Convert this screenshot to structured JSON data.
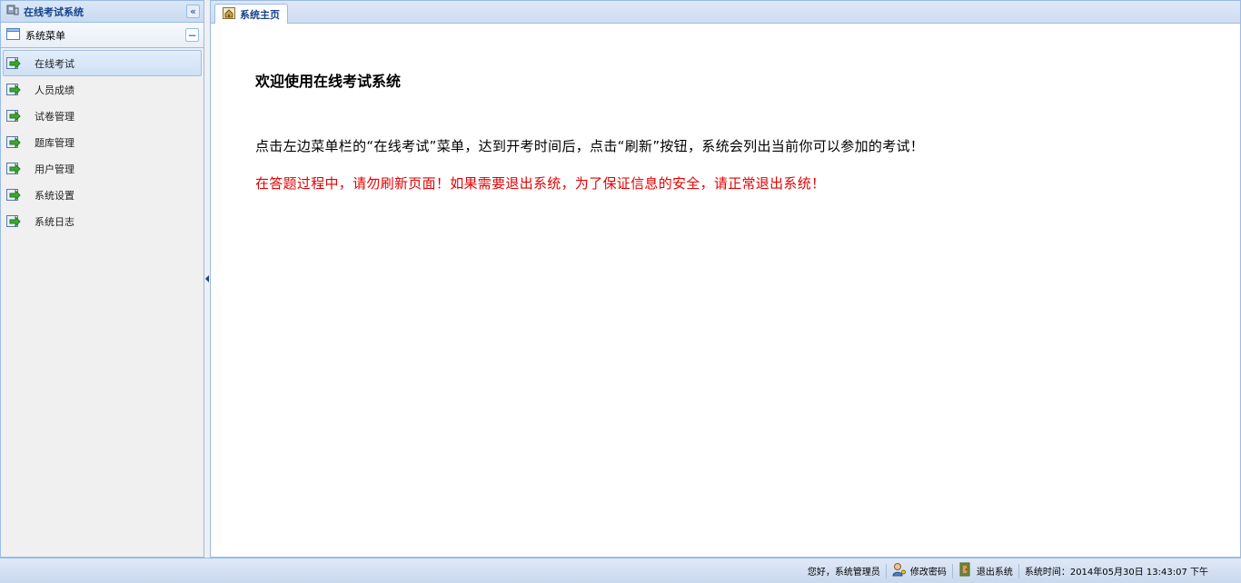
{
  "west": {
    "title": "在线考试系统",
    "collapse_glyph": "«",
    "accordion_label": "系统菜单",
    "accordion_toggle": "−",
    "menu": [
      {
        "label": "在线考试",
        "icon": "arrow-right-icon"
      },
      {
        "label": "人员成绩",
        "icon": "arrow-right-icon"
      },
      {
        "label": "试卷管理",
        "icon": "arrow-right-icon"
      },
      {
        "label": "题库管理",
        "icon": "arrow-right-icon"
      },
      {
        "label": "用户管理",
        "icon": "arrow-right-icon"
      },
      {
        "label": "系统设置",
        "icon": "arrow-right-icon"
      },
      {
        "label": "系统日志",
        "icon": "arrow-right-icon"
      }
    ]
  },
  "tabs": [
    {
      "label": "系统主页",
      "icon": "home-icon"
    }
  ],
  "content": {
    "welcome": "欢迎使用在线考试系统",
    "instruction": "点击左边菜单栏的“在线考试”菜单，达到开考时间后，点击“刷新”按钮，系统会列出当前你可以参加的考试！",
    "warning": "在答题过程中，请勿刷新页面！如果需要退出系统，为了保证信息的安全，请正常退出系统！"
  },
  "footer": {
    "greeting": "您好，系统管理员",
    "change_password": "修改密码",
    "logout": "退出系统",
    "time_label": "系统时间：",
    "time_value": "2014年05月30日 13:43:07 下午"
  },
  "colors": {
    "accent": "#15428b",
    "border": "#99bbe8",
    "warning": "#e60000"
  }
}
